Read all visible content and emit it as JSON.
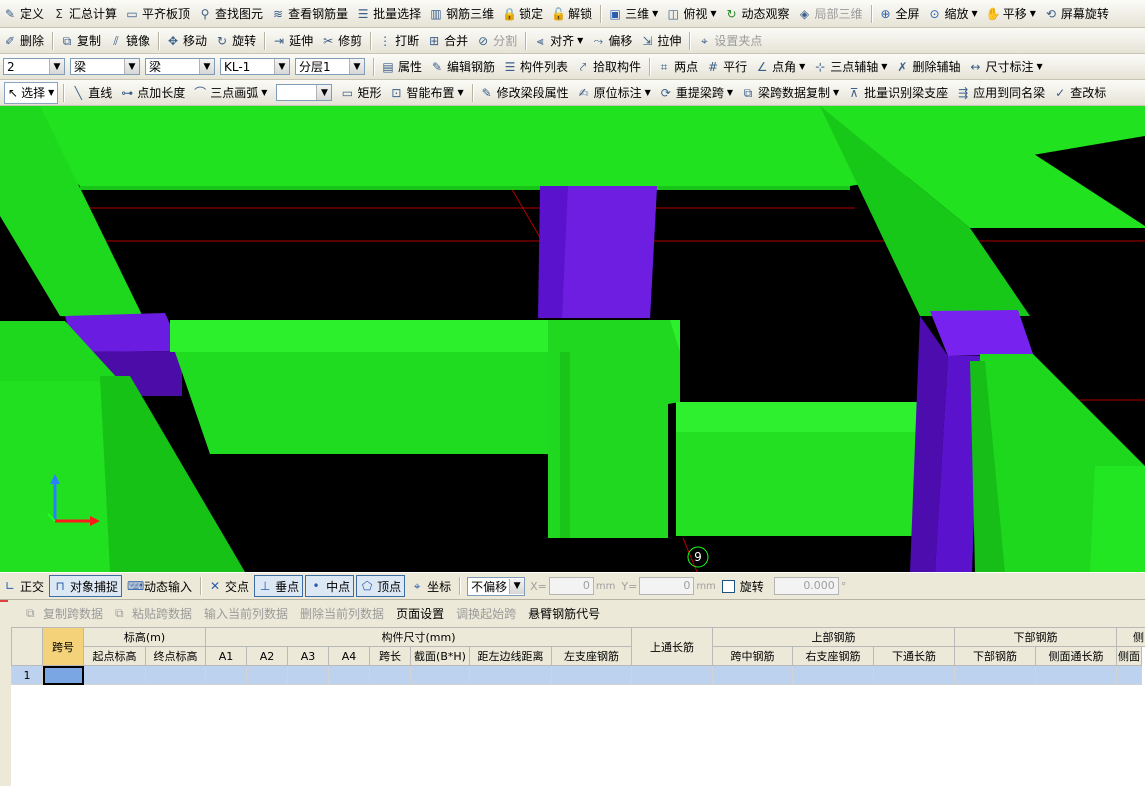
{
  "toolbar1": {
    "items": [
      {
        "label": "定义",
        "icon": "define-icon"
      },
      {
        "label": "汇总计算",
        "icon": "sigma-icon"
      },
      {
        "label": "平齐板顶",
        "icon": "align-top-icon"
      },
      {
        "label": "查找图元",
        "icon": "binoculars-icon"
      },
      {
        "label": "查看钢筋量",
        "icon": "rebar-quantity-icon"
      },
      {
        "label": "批量选择",
        "icon": "batch-select-icon"
      },
      {
        "label": "钢筋三维",
        "icon": "rebar-3d-icon"
      },
      {
        "label": "锁定",
        "icon": "lock-icon"
      },
      {
        "label": "解锁",
        "icon": "unlock-icon"
      },
      {
        "label": "三维",
        "icon": "cube-icon"
      },
      {
        "label": "俯视",
        "icon": "top-view-icon"
      },
      {
        "label": "动态观察",
        "icon": "orbit-icon"
      },
      {
        "label": "局部三维",
        "icon": "local-3d-icon"
      },
      {
        "label": "全屏",
        "icon": "fullscreen-icon"
      },
      {
        "label": "缩放",
        "icon": "zoom-icon"
      },
      {
        "label": "平移",
        "icon": "pan-icon"
      },
      {
        "label": "屏幕旋转",
        "icon": "screen-rotate-icon"
      }
    ]
  },
  "toolbar2": {
    "items": [
      {
        "label": "删除",
        "icon": "eraser-icon"
      },
      {
        "label": "复制",
        "icon": "copy-icon"
      },
      {
        "label": "镜像",
        "icon": "mirror-icon"
      },
      {
        "label": "移动",
        "icon": "move-icon"
      },
      {
        "label": "旋转",
        "icon": "rotate-icon"
      },
      {
        "label": "延伸",
        "icon": "extend-icon"
      },
      {
        "label": "修剪",
        "icon": "trim-icon"
      },
      {
        "label": "打断",
        "icon": "break-icon"
      },
      {
        "label": "合并",
        "icon": "merge-icon"
      },
      {
        "label": "分割",
        "icon": "split-icon"
      },
      {
        "label": "对齐",
        "icon": "align-icon"
      },
      {
        "label": "偏移",
        "icon": "offset-icon"
      },
      {
        "label": "拉伸",
        "icon": "stretch-icon"
      },
      {
        "label": "设置夹点",
        "icon": "grip-icon"
      }
    ]
  },
  "toolbar3": {
    "floor": "2",
    "category": "梁",
    "type": "梁",
    "name": "KL-1",
    "layer": "分层1",
    "items": [
      {
        "label": "属性",
        "icon": "properties-icon"
      },
      {
        "label": "编辑钢筋",
        "icon": "edit-rebar-icon"
      },
      {
        "label": "构件列表",
        "icon": "component-list-icon"
      },
      {
        "label": "拾取构件",
        "icon": "pick-icon"
      },
      {
        "label": "两点",
        "icon": "two-point-axis-icon"
      },
      {
        "label": "平行",
        "icon": "parallel-axis-icon"
      },
      {
        "label": "点角",
        "icon": "point-angle-icon"
      },
      {
        "label": "三点辅轴",
        "icon": "three-point-axis-icon"
      },
      {
        "label": "删除辅轴",
        "icon": "delete-axis-icon"
      },
      {
        "label": "尺寸标注",
        "icon": "dimension-icon"
      }
    ]
  },
  "toolbar4": {
    "select_label": "选择",
    "items": [
      {
        "label": "直线",
        "icon": "line-icon"
      },
      {
        "label": "点加长度",
        "icon": "point-length-icon"
      },
      {
        "label": "三点画弧",
        "icon": "arc-icon"
      },
      {
        "label": "矩形",
        "icon": "rectangle-icon"
      },
      {
        "label": "智能布置",
        "icon": "smart-layout-icon"
      },
      {
        "label": "修改梁段属性",
        "icon": "modify-beam-icon"
      },
      {
        "label": "原位标注",
        "icon": "in-place-mark-icon"
      },
      {
        "label": "重提梁跨",
        "icon": "re-extract-span-icon"
      },
      {
        "label": "梁跨数据复制",
        "icon": "copy-span-data-icon"
      },
      {
        "label": "批量识别梁支座",
        "icon": "identify-support-icon"
      },
      {
        "label": "应用到同名梁",
        "icon": "apply-same-name-icon"
      },
      {
        "label": "查改标",
        "icon": "check-mark-icon"
      }
    ]
  },
  "viewport": {
    "marker": "9",
    "colors": {
      "beam": "#21e21e",
      "beam_dark": "#14b514",
      "column": "#5a12cc",
      "column_top": "#7722ee",
      "axis_line": "#b00000"
    }
  },
  "snapbar": {
    "items": [
      {
        "label": "正交",
        "icon": "ortho-icon",
        "on": false
      },
      {
        "label": "对象捕捉",
        "icon": "object-snap-icon",
        "on": true
      },
      {
        "label": "动态输入",
        "icon": "dynamic-input-icon",
        "on": false
      },
      {
        "label": "交点",
        "icon": "intersection-icon",
        "on": false
      },
      {
        "label": "垂点",
        "icon": "perpendicular-icon",
        "on": true
      },
      {
        "label": "中点",
        "icon": "midpoint-icon",
        "on": true
      },
      {
        "label": "顶点",
        "icon": "vertex-icon",
        "on": true
      },
      {
        "label": "坐标",
        "icon": "coordinate-icon",
        "on": false
      }
    ],
    "offset_mode": "不偏移",
    "x_label": "X=",
    "x_value": "0",
    "y_label": "Y=",
    "y_value": "0",
    "unit": "mm",
    "rotate_label": "旋转",
    "rotate_value": "0.000",
    "degree": "°"
  },
  "gridbar": {
    "items": [
      {
        "label": "复制跨数据",
        "enabled": false
      },
      {
        "label": "粘贴跨数据",
        "enabled": false
      },
      {
        "label": "输入当前列数据",
        "enabled": false
      },
      {
        "label": "删除当前列数据",
        "enabled": false
      },
      {
        "label": "页面设置",
        "enabled": true
      },
      {
        "label": "调换起始跨",
        "enabled": false
      },
      {
        "label": "悬臂钢筋代号",
        "enabled": true
      }
    ]
  },
  "table": {
    "group_headers": {
      "span": "跨号",
      "elevation": "标高(m)",
      "size": "构件尺寸(mm)",
      "top_through": "上通长筋",
      "top_rebar": "上部钢筋",
      "bottom_rebar": "下部钢筋",
      "side": "侧"
    },
    "sub_headers": [
      "起点标高",
      "终点标高",
      "A1",
      "A2",
      "A3",
      "A4",
      "跨长",
      "截面(B*H)",
      "距左边线距离",
      "左支座钢筋",
      "跨中钢筋",
      "右支座钢筋",
      "下通长筋",
      "下部钢筋",
      "侧面通长筋",
      "侧面"
    ],
    "rows": [
      {
        "num": "1"
      }
    ]
  }
}
